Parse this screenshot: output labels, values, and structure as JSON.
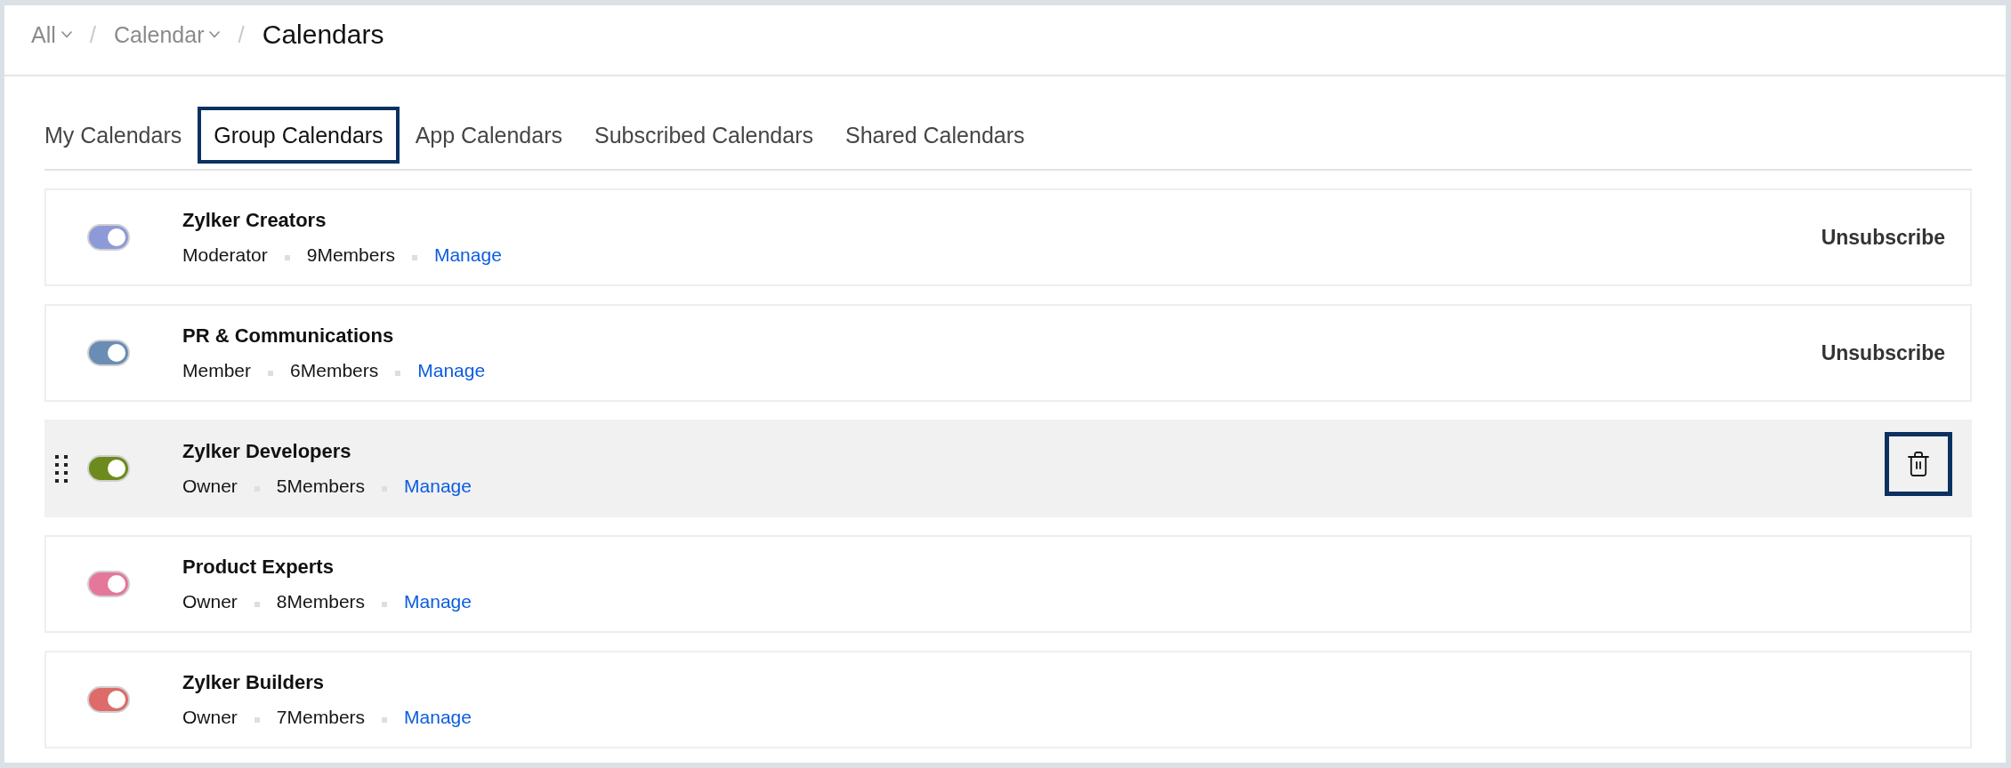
{
  "breadcrumb": [
    {
      "kind": "dropdown",
      "label": "All"
    },
    {
      "kind": "separator",
      "label": "/"
    },
    {
      "kind": "dropdown",
      "label": "Calendar"
    },
    {
      "kind": "separator",
      "label": "/"
    },
    {
      "kind": "current",
      "label": "Calendars"
    }
  ],
  "tabs": [
    {
      "label": "My Calendars",
      "selected": false
    },
    {
      "label": "Group Calendars",
      "selected": true
    },
    {
      "label": "App Calendars",
      "selected": false
    },
    {
      "label": "Subscribed Calendars",
      "selected": false
    },
    {
      "label": "Shared Calendars",
      "selected": false
    }
  ],
  "calendars": [
    {
      "name": "Zylker Creators",
      "on": true,
      "color": "#8e9ad8",
      "hovered": false,
      "role": "Moderator",
      "members": "9Members",
      "link": "Manage",
      "action": {
        "kind": "text",
        "label": "Unsubscribe"
      }
    },
    {
      "name": "PR & Communications",
      "on": true,
      "color": "#6a8db5",
      "hovered": false,
      "role": "Member",
      "members": "6Members",
      "link": "Manage",
      "action": {
        "kind": "text",
        "label": "Unsubscribe"
      }
    },
    {
      "name": "Zylker Developers",
      "on": true,
      "color": "#6d8a1c",
      "hovered": true,
      "role": "Owner",
      "members": "5Members",
      "link": "Manage",
      "action": {
        "kind": "delete",
        "focused": true
      }
    },
    {
      "name": "Product Experts",
      "on": true,
      "color": "#e5779b",
      "hovered": false,
      "role": "Owner",
      "members": "8Members",
      "link": "Manage"
    },
    {
      "name": "Zylker Builders",
      "on": true,
      "color": "#dd6b6a",
      "hovered": false,
      "role": "Owner",
      "members": "7Members",
      "link": "Manage"
    }
  ]
}
